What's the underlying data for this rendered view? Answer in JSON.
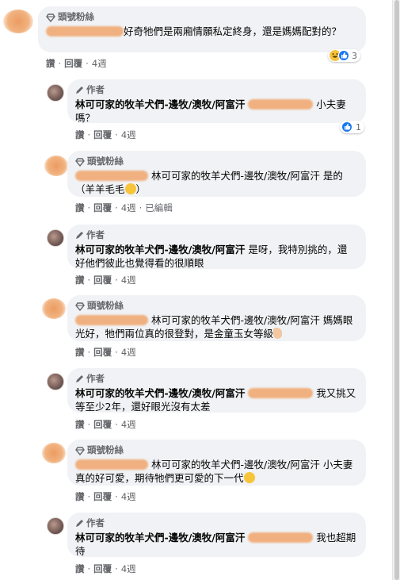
{
  "badges": {
    "fan": "頭號粉絲",
    "author": "作者"
  },
  "actions": {
    "like": "讚",
    "reply": "回覆",
    "separator": "·",
    "edited": "已編輯"
  },
  "page_name": "林可可家的牧羊犬們-邊牧/澳牧/阿富汗",
  "comments": [
    {
      "type": "fan",
      "text_before": "",
      "text_after": "好奇牠們是兩廂情願私定終身，還是媽媽配對的？",
      "time": "4週",
      "reactions_count": "3"
    },
    {
      "type": "author",
      "text_after": "小夫妻嗎？",
      "time": "4週",
      "reactions_count": "1"
    },
    {
      "type": "fan",
      "text_after": "是的（羊羊毛毛",
      "time": "4週",
      "edited": true
    },
    {
      "type": "author",
      "text_after": "是呀，我特別挑的，還好他們彼此也覺得看的很順眼",
      "time": "4週"
    },
    {
      "type": "fan",
      "text_after": "媽媽眼光好，牠們兩位真的很登對，是金童玉女等級",
      "time": "4週"
    },
    {
      "type": "author",
      "text_after": "我又挑又等至少2年，還好眼光沒有太差",
      "time": "4週"
    },
    {
      "type": "fan",
      "text_after": "小夫妻真的好可愛，期待牠們更可愛的下一代",
      "time": "4週"
    },
    {
      "type": "author",
      "text_after": "我也超期待",
      "time": "4週"
    }
  ],
  "colors": {
    "bubble": "#f0f2f5",
    "like_blue": "#1877f2",
    "meta_gray": "#65676b"
  }
}
